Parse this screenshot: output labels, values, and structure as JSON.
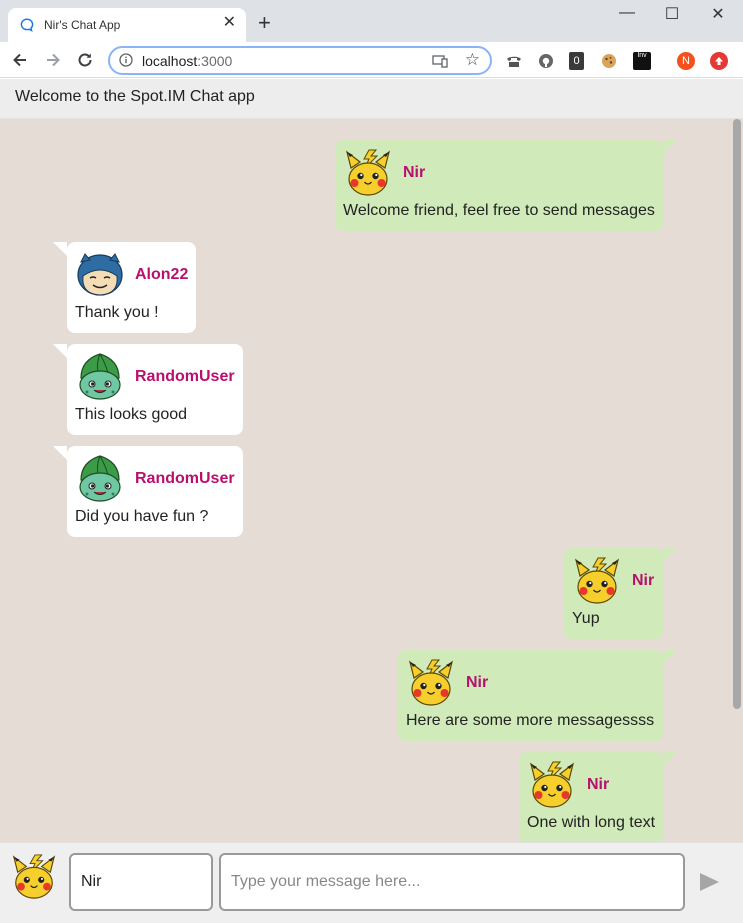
{
  "browser": {
    "tab_title": "Nir's Chat App",
    "tab_close": "✕",
    "new_tab": "+",
    "url_host": "localhost",
    "url_port": ":3000",
    "window_controls": [
      "—",
      "☐",
      "✕"
    ],
    "extensions": [
      {
        "icon": "phone-extension-icon"
      },
      {
        "icon": "privacy-extension-icon"
      },
      {
        "icon": "counter-extension-icon",
        "label": "0"
      },
      {
        "icon": "cookie-extension-icon"
      },
      {
        "icon": "investing-extension-icon",
        "label": "Inv"
      },
      {
        "icon": "profile-avatar-icon",
        "label": "N",
        "color": "#f4511e"
      },
      {
        "icon": "update-extension-icon",
        "color": "#e53935"
      }
    ]
  },
  "app": {
    "header_title": "Welcome to the Spot.IM Chat app",
    "messages": [
      {
        "author": "Nir",
        "avatar": "pikachu-avatar",
        "text": "Welcome friend, feel free to send messages",
        "mine": true
      },
      {
        "author": "Alon22",
        "avatar": "snorlax-avatar",
        "text": "Thank you !",
        "mine": false
      },
      {
        "author": "RandomUser",
        "avatar": "bulbasaur-avatar",
        "text": "This looks good",
        "mine": false
      },
      {
        "author": "RandomUser",
        "avatar": "bulbasaur-avatar",
        "text": "Did you have fun ?",
        "mine": false
      },
      {
        "author": "Nir",
        "avatar": "pikachu-avatar",
        "text": "Yup",
        "mine": true
      },
      {
        "author": "Nir",
        "avatar": "pikachu-avatar",
        "text": "Here are some more messagessss",
        "mine": true
      },
      {
        "author": "Nir",
        "avatar": "pikachu-avatar",
        "text": "One with long text",
        "mine": true
      }
    ],
    "composer": {
      "username_value": "Nir",
      "message_placeholder": "Type your message here..."
    }
  },
  "colors": {
    "chat_background": "#e5ddd5",
    "my_bubble": "#d0eaba",
    "their_bubble": "#ffffff",
    "author_name": "#b8106f"
  }
}
